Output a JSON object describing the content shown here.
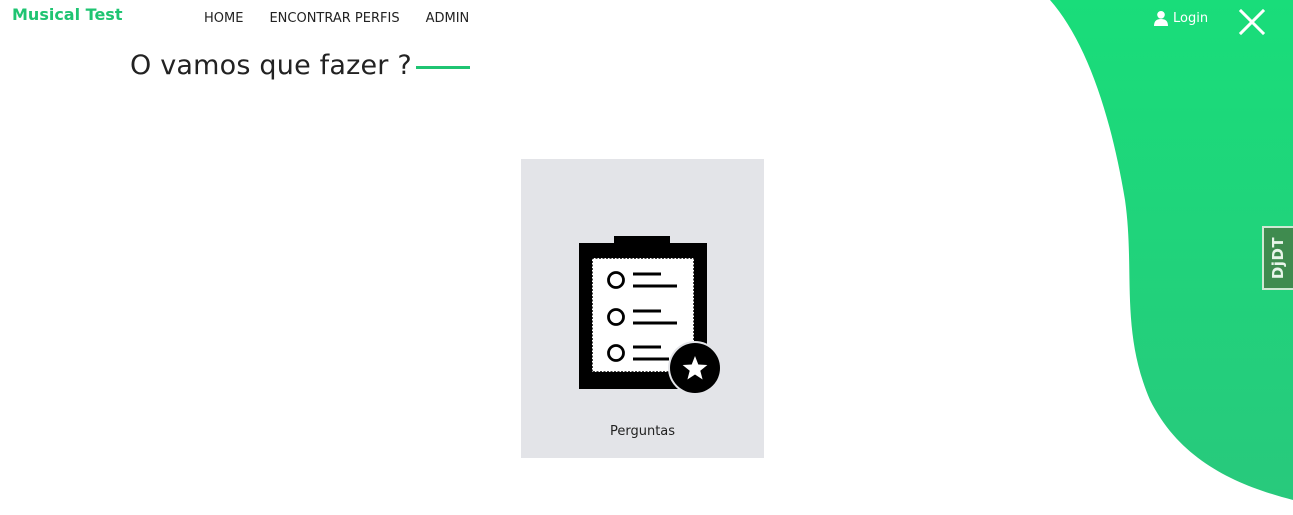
{
  "brand": {
    "name": "Musical Test",
    "color": "#1fc472"
  },
  "nav": {
    "items": [
      {
        "label": "HOME"
      },
      {
        "label": "ENCONTRAR PERFIS"
      },
      {
        "label": "ADMIN"
      }
    ]
  },
  "header_right": {
    "login_label": "Login",
    "login_icon": "user-icon",
    "close_icon": "close-icon"
  },
  "section": {
    "title": "O vamos que fazer ?",
    "accent_color": "#1fc472"
  },
  "cards": [
    {
      "label": "Perguntas",
      "icon": "clipboard-checklist-star-icon"
    }
  ],
  "debug_toolbar": {
    "label": "DjDT"
  },
  "theme": {
    "blob_color": "#19dd7a",
    "blob_color_end": "#26c97a",
    "card_bg": "#e3e4e8"
  }
}
